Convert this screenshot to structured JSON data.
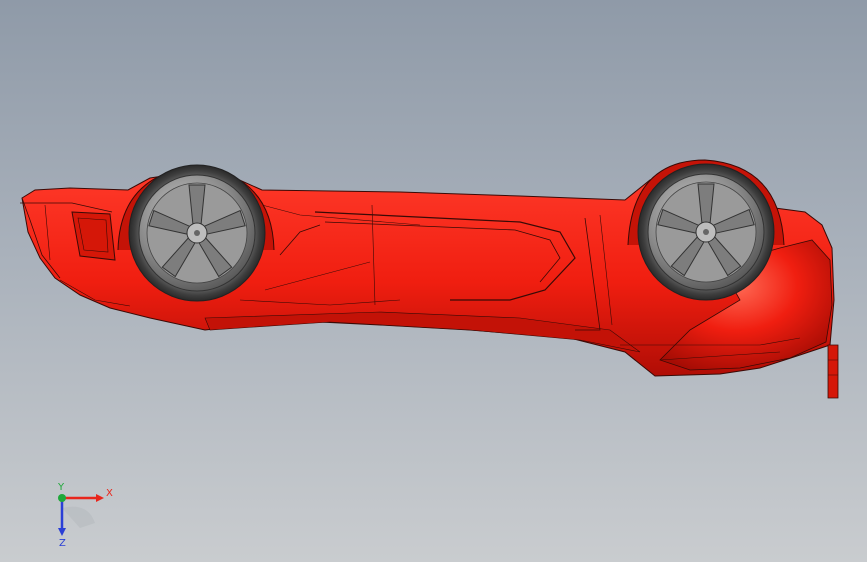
{
  "viewport": {
    "background_top": "#8f9aa8",
    "background_bottom": "#c9cccf"
  },
  "model": {
    "body_color": "#f01e10",
    "body_shadow": "#b00d05",
    "edge_color": "#3a0a06",
    "wheel_color": "#4a4a4a"
  },
  "triad": {
    "x_label": "X",
    "y_label": "Y",
    "z_label": "Z",
    "x_color": "#e8261c",
    "y_color": "#1fa83a",
    "z_color": "#2a3fd6"
  }
}
